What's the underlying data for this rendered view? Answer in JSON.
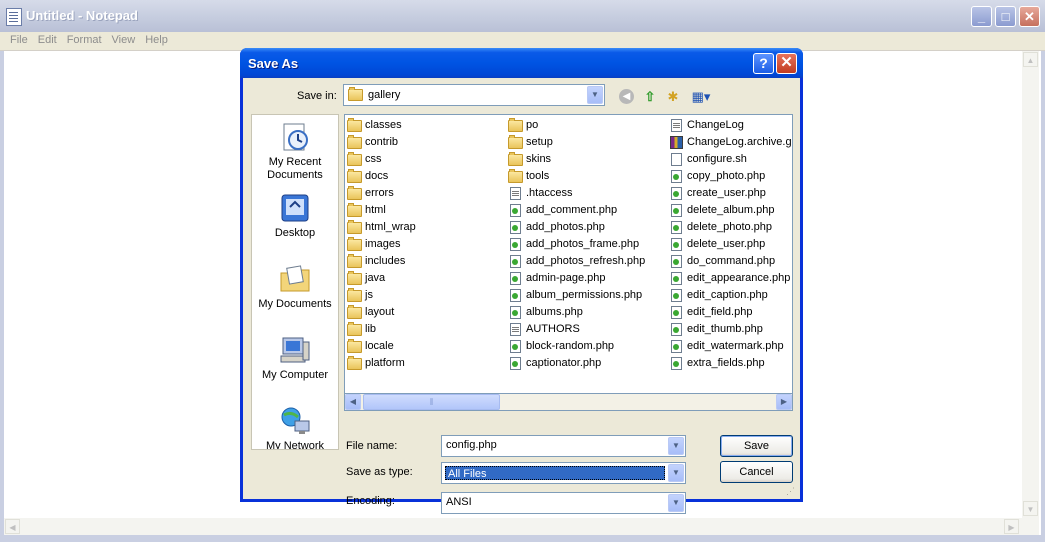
{
  "notepad": {
    "title": "Untitled - Notepad",
    "menu": [
      "File",
      "Edit",
      "Format",
      "View",
      "Help"
    ],
    "buttons": {
      "minimize": "_",
      "maximize": "□",
      "close": "✕"
    }
  },
  "dialog": {
    "title": "Save As",
    "help_glyph": "?",
    "close_glyph": "✕",
    "save_in_label": "Save in:",
    "save_in_value": "gallery",
    "places": [
      {
        "label": "My Recent Documents",
        "icon": "recent-documents-icon"
      },
      {
        "label": "Desktop",
        "icon": "desktop-icon"
      },
      {
        "label": "My Documents",
        "icon": "my-documents-icon"
      },
      {
        "label": "My Computer",
        "icon": "my-computer-icon"
      },
      {
        "label": "My Network",
        "icon": "my-network-icon"
      }
    ],
    "files": {
      "col1": [
        {
          "name": "classes",
          "type": "folder"
        },
        {
          "name": "contrib",
          "type": "folder"
        },
        {
          "name": "css",
          "type": "folder"
        },
        {
          "name": "docs",
          "type": "folder"
        },
        {
          "name": "errors",
          "type": "folder"
        },
        {
          "name": "html",
          "type": "folder"
        },
        {
          "name": "html_wrap",
          "type": "folder"
        },
        {
          "name": "images",
          "type": "folder"
        },
        {
          "name": "includes",
          "type": "folder"
        },
        {
          "name": "java",
          "type": "folder"
        },
        {
          "name": "js",
          "type": "folder"
        },
        {
          "name": "layout",
          "type": "folder"
        },
        {
          "name": "lib",
          "type": "folder"
        },
        {
          "name": "locale",
          "type": "folder"
        },
        {
          "name": "platform",
          "type": "folder"
        }
      ],
      "col2": [
        {
          "name": "po",
          "type": "folder"
        },
        {
          "name": "setup",
          "type": "folder"
        },
        {
          "name": "skins",
          "type": "folder"
        },
        {
          "name": "tools",
          "type": "folder"
        },
        {
          "name": ".htaccess",
          "type": "txt"
        },
        {
          "name": "add_comment.php",
          "type": "php"
        },
        {
          "name": "add_photos.php",
          "type": "php"
        },
        {
          "name": "add_photos_frame.php",
          "type": "php"
        },
        {
          "name": "add_photos_refresh.php",
          "type": "php"
        },
        {
          "name": "admin-page.php",
          "type": "php"
        },
        {
          "name": "album_permissions.php",
          "type": "php"
        },
        {
          "name": "albums.php",
          "type": "php"
        },
        {
          "name": "AUTHORS",
          "type": "txt"
        },
        {
          "name": "block-random.php",
          "type": "php"
        },
        {
          "name": "captionator.php",
          "type": "php"
        }
      ],
      "col3": [
        {
          "name": "ChangeLog",
          "type": "txt"
        },
        {
          "name": "ChangeLog.archive.gz",
          "type": "gz"
        },
        {
          "name": "configure.sh",
          "type": "sh"
        },
        {
          "name": "copy_photo.php",
          "type": "php"
        },
        {
          "name": "create_user.php",
          "type": "php"
        },
        {
          "name": "delete_album.php",
          "type": "php"
        },
        {
          "name": "delete_photo.php",
          "type": "php"
        },
        {
          "name": "delete_user.php",
          "type": "php"
        },
        {
          "name": "do_command.php",
          "type": "php"
        },
        {
          "name": "edit_appearance.php",
          "type": "php"
        },
        {
          "name": "edit_caption.php",
          "type": "php"
        },
        {
          "name": "edit_field.php",
          "type": "php"
        },
        {
          "name": "edit_thumb.php",
          "type": "php"
        },
        {
          "name": "edit_watermark.php",
          "type": "php"
        },
        {
          "name": "extra_fields.php",
          "type": "php"
        }
      ]
    },
    "file_name_label": "File name:",
    "file_name_value": "config.php",
    "save_type_label": "Save as type:",
    "save_type_value": "All Files",
    "encoding_label": "Encoding:",
    "encoding_value": "ANSI",
    "save_button": "Save",
    "cancel_button": "Cancel"
  }
}
